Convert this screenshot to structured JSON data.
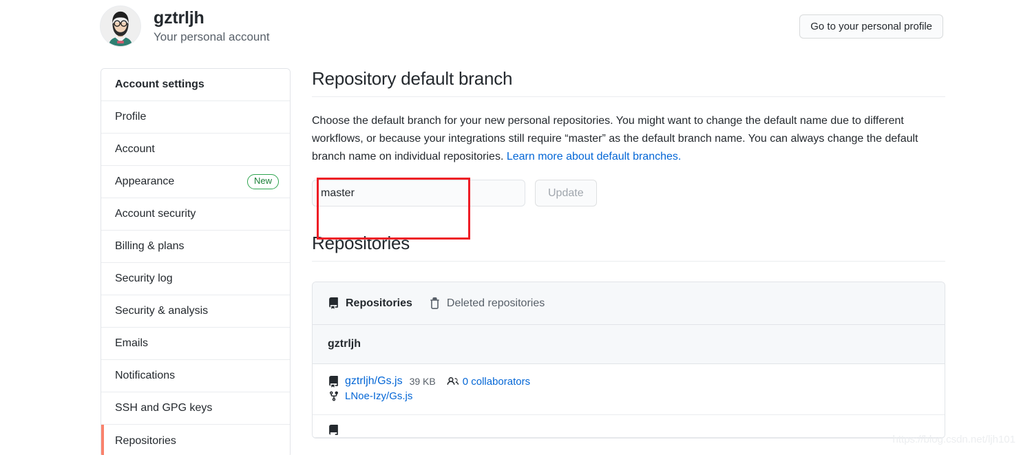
{
  "account": {
    "login": "gztrljh",
    "subtitle": "Your personal account",
    "avatar_icon": "user-avatar-illustration",
    "profile_button": "Go to your personal profile"
  },
  "sidebar": {
    "heading": "Account settings",
    "items": [
      {
        "label": "Profile",
        "badge": "",
        "active": false
      },
      {
        "label": "Account",
        "badge": "",
        "active": false
      },
      {
        "label": "Appearance",
        "badge": "New",
        "active": false
      },
      {
        "label": "Account security",
        "badge": "",
        "active": false
      },
      {
        "label": "Billing & plans",
        "badge": "",
        "active": false
      },
      {
        "label": "Security log",
        "badge": "",
        "active": false
      },
      {
        "label": "Security & analysis",
        "badge": "",
        "active": false
      },
      {
        "label": "Emails",
        "badge": "",
        "active": false
      },
      {
        "label": "Notifications",
        "badge": "",
        "active": false
      },
      {
        "label": "SSH and GPG keys",
        "badge": "",
        "active": false
      },
      {
        "label": "Repositories",
        "badge": "",
        "active": true
      }
    ],
    "active_indicator_color": "#f9826c",
    "badge_color": "#2da44e"
  },
  "default_branch": {
    "title": "Repository default branch",
    "description_part1": "Choose the default branch for your new personal repositories. You might want to change the default name due to different workflows, or because your integrations still require “master” as the default branch name. You can always change the default branch name on individual repositories. ",
    "link_text": "Learn more about default branches.",
    "input_value": "master",
    "input_placeholder": "master",
    "update_label": "Update",
    "update_disabled": true,
    "annotation_color": "#ee1c25"
  },
  "repositories": {
    "title": "Repositories",
    "tabs": [
      {
        "label": "Repositories",
        "icon": "repo-icon",
        "active": true
      },
      {
        "label": "Deleted repositories",
        "icon": "trash-icon",
        "active": false
      }
    ],
    "group_owner": "gztrljh",
    "rows": [
      {
        "icon": "repo-icon",
        "name": "gztrljh/Gs.js",
        "size": "39 KB",
        "collaborators_icon": "people-icon",
        "collaborators": "0 collaborators",
        "fork_icon": "repo-forked-icon",
        "forked_from": "LNoe-Izy/Gs.js"
      }
    ]
  },
  "watermark": "https://blog.csdn.net/ljh101",
  "colors": {
    "link": "#0366d6",
    "border": "#e1e4e8",
    "muted_text": "#586069",
    "surface": "#f6f8fa"
  }
}
